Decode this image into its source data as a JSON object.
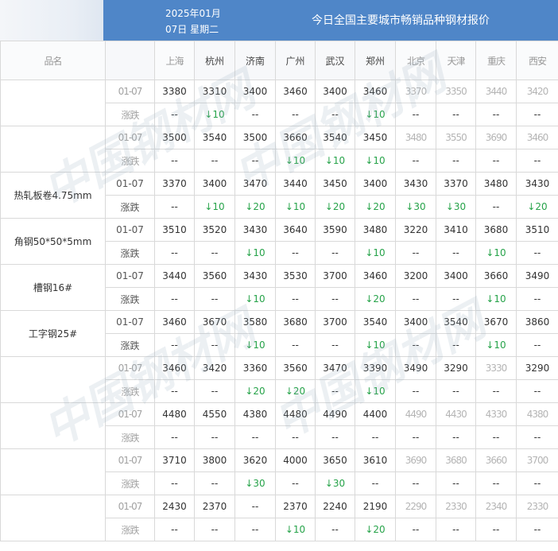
{
  "header": {
    "date_line1": "2025年01月",
    "date_line2": "07日  星期二",
    "title": "今日全国主要城市畅销品种钢材报价"
  },
  "colors": {
    "header_bg": "#4f86c8",
    "down": "#27a34a"
  },
  "columns": [
    "品名",
    "",
    "上海",
    "杭州",
    "济南",
    "广州",
    "武汉",
    "郑州",
    "北京",
    "天津",
    "重庆",
    "西安"
  ],
  "column_blur": [
    true,
    false,
    true,
    false,
    false,
    false,
    false,
    false,
    true,
    true,
    true,
    true
  ],
  "rows": [
    {
      "product": "",
      "blur": true,
      "price_label": "01-07",
      "change_label": "涨跌",
      "prices": [
        "3380",
        "3310",
        "3400",
        "3460",
        "3400",
        "3460",
        "3370",
        "3350",
        "3440",
        "3420"
      ],
      "changes": [
        "--",
        "↓10",
        "--",
        "--",
        "--",
        "↓10",
        "--",
        "--",
        "--",
        "--"
      ]
    },
    {
      "product": "",
      "blur": true,
      "price_label": "01-07",
      "change_label": "涨跌",
      "prices": [
        "3500",
        "3540",
        "3500",
        "3660",
        "3540",
        "3450",
        "3480",
        "3550",
        "3690",
        "3460"
      ],
      "changes": [
        "--",
        "--",
        "--",
        "↓10",
        "↓10",
        "↓10",
        "--",
        "--",
        "--",
        "--"
      ]
    },
    {
      "product": "热轧板卷4.75mm",
      "blur": false,
      "price_label": "01-07",
      "change_label": "涨跌",
      "prices": [
        "3370",
        "3400",
        "3470",
        "3440",
        "3450",
        "3400",
        "3430",
        "3370",
        "3480",
        "3430"
      ],
      "changes": [
        "--",
        "↓10",
        "↓20",
        "↓10",
        "↓20",
        "↓20",
        "↓30",
        "↓30",
        "--",
        "↓20"
      ]
    },
    {
      "product": "角钢50*50*5mm",
      "blur": false,
      "price_label": "01-07",
      "change_label": "涨跌",
      "prices": [
        "3510",
        "3520",
        "3430",
        "3640",
        "3590",
        "3480",
        "3220",
        "3410",
        "3680",
        "3510"
      ],
      "changes": [
        "--",
        "--",
        "↓10",
        "--",
        "--",
        "↓10",
        "--",
        "--",
        "↓10",
        "--"
      ]
    },
    {
      "product": "槽钢16#",
      "blur": false,
      "price_label": "01-07",
      "change_label": "涨跌",
      "prices": [
        "3440",
        "3560",
        "3430",
        "3530",
        "3700",
        "3460",
        "3200",
        "3400",
        "3660",
        "3490"
      ],
      "changes": [
        "--",
        "--",
        "↓10",
        "--",
        "--",
        "↓20",
        "--",
        "--",
        "↓10",
        "--"
      ]
    },
    {
      "product": "工字钢25#",
      "blur": false,
      "price_label": "01-07",
      "change_label": "涨跌",
      "prices": [
        "3460",
        "3670",
        "3580",
        "3680",
        "3700",
        "3540",
        "3400",
        "3540",
        "3670",
        "3860"
      ],
      "changes": [
        "--",
        "--",
        "↓10",
        "--",
        "--",
        "↓10",
        "--",
        "--",
        "↓10",
        "--"
      ]
    },
    {
      "product": "",
      "blur": true,
      "price_label": "01-07",
      "change_label": "涨跌",
      "prices": [
        "3460",
        "3420",
        "3360",
        "3560",
        "3470",
        "3390",
        "3490",
        "3290",
        "3330",
        "3290"
      ],
      "changes": [
        "--",
        "--",
        "↓20",
        "↓20",
        "--",
        "↓10",
        "--",
        "--",
        "--",
        "--"
      ]
    },
    {
      "product": "",
      "blur": true,
      "price_label": "01-07",
      "change_label": "涨跌",
      "prices": [
        "4480",
        "4550",
        "4380",
        "4480",
        "4490",
        "4400",
        "4490",
        "4430",
        "4330",
        "4380"
      ],
      "changes": [
        "--",
        "--",
        "--",
        "--",
        "--",
        "--",
        "--",
        "--",
        "--",
        "--"
      ]
    },
    {
      "product": "",
      "blur": true,
      "price_label": "01-07",
      "change_label": "涨跌",
      "prices": [
        "3710",
        "3800",
        "3620",
        "4000",
        "3650",
        "3610",
        "3690",
        "3680",
        "3660",
        "3700"
      ],
      "changes": [
        "--",
        "--",
        "↓30",
        "--",
        "↓30",
        "--",
        "--",
        "--",
        "--",
        "--"
      ]
    },
    {
      "product": "",
      "blur": true,
      "price_label": "01-07",
      "change_label": "涨跌",
      "prices": [
        "2430",
        "2370",
        "--",
        "2370",
        "2240",
        "2190",
        "2290",
        "2330",
        "2340",
        "2330"
      ],
      "changes": [
        "--",
        "--",
        "--",
        "↓10",
        "--",
        "↓20",
        "--",
        "--",
        "--",
        "--"
      ]
    }
  ],
  "blurred_price_cols": [
    [
      6,
      7,
      8,
      9
    ],
    [
      6,
      7,
      8,
      9
    ],
    [],
    [],
    [],
    [],
    [
      8
    ],
    [
      6,
      7,
      8,
      9
    ],
    [
      6,
      7,
      8,
      9
    ],
    [
      6,
      7,
      8,
      9
    ]
  ],
  "watermark": "中国钢材网"
}
